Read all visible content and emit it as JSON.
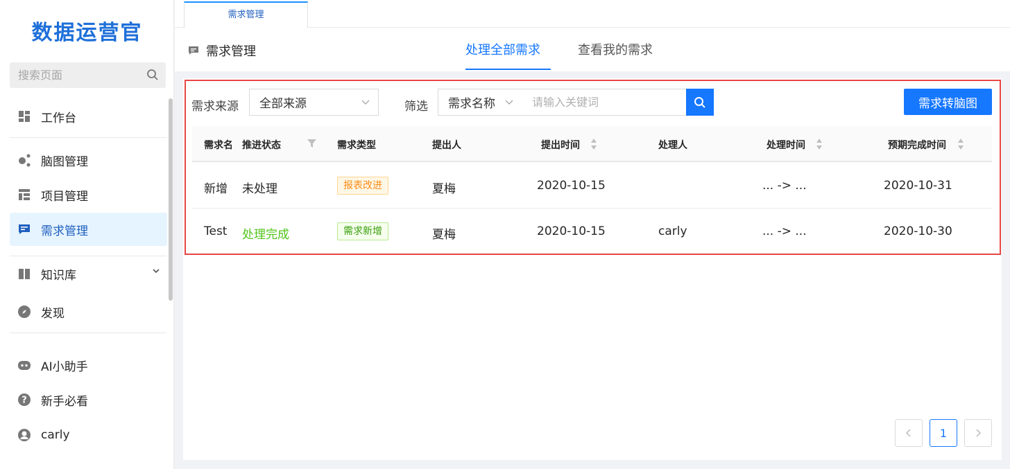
{
  "app": {
    "logo": "数据运营官"
  },
  "sidebar": {
    "search_placeholder": "搜索页面",
    "items": [
      {
        "label": "工作台",
        "icon": "dashboard-icon"
      },
      {
        "label": "脑图管理",
        "icon": "mindmap-icon"
      },
      {
        "label": "项目管理",
        "icon": "project-icon"
      },
      {
        "label": "需求管理",
        "icon": "message-icon",
        "active": true
      },
      {
        "label": "知识库",
        "icon": "book-icon"
      },
      {
        "label": "发现",
        "icon": "compass-icon"
      },
      {
        "label": "AI小助手",
        "icon": "robot-icon"
      },
      {
        "label": "新手必看",
        "icon": "question-icon"
      },
      {
        "label": "carly",
        "icon": "user-icon"
      }
    ]
  },
  "topbar": {
    "tab_label": "需求管理"
  },
  "header": {
    "title": "需求管理",
    "tabs": [
      {
        "label": "处理全部需求",
        "active": true
      },
      {
        "label": "查看我的需求",
        "active": false
      }
    ]
  },
  "filters": {
    "source_label": "需求来源",
    "source_value": "全部来源",
    "filter_label": "筛选",
    "field_value": "需求名称",
    "keyword_placeholder": "请输入关键词",
    "convert_button": "需求转脑图"
  },
  "table": {
    "columns": [
      "需求名称",
      "推进状态",
      "需求类型",
      "提出人",
      "提出时间",
      "处理人",
      "处理时间",
      "预期完成时间"
    ],
    "rows": [
      {
        "name": "新增",
        "status": "未处理",
        "type": "报表改进",
        "proposer": "夏梅",
        "proposed_at": "2020-10-15",
        "handler": "",
        "handle_time": "... -> ...",
        "expected": "2020-10-31"
      },
      {
        "name": "Test",
        "status": "处理完成",
        "type": "需求新增",
        "proposer": "夏梅",
        "proposed_at": "2020-10-15",
        "handler": "carly",
        "handle_time": "... -> ...",
        "expected": "2020-10-30"
      }
    ]
  },
  "pagination": {
    "current": "1"
  },
  "colors": {
    "primary": "#1677ff",
    "success": "#52c41a",
    "warning": "#fa8c16",
    "highlight": "#e84545"
  }
}
